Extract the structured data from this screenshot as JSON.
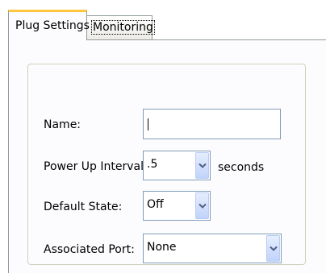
{
  "tabs": [
    {
      "label": "Plug Settings",
      "active": true
    },
    {
      "label": "Monitoring",
      "active": false
    }
  ],
  "form": {
    "name": {
      "label": "Name:",
      "value": ""
    },
    "power_up_interval": {
      "label": "Power Up Interval:",
      "value": ".5",
      "unit": "seconds"
    },
    "default_state": {
      "label": "Default State:",
      "value": "Off"
    },
    "associated_port": {
      "label": "Associated Port:",
      "value": "None"
    }
  },
  "icons": {
    "dropdown": "chevron-down-icon"
  },
  "colors": {
    "active_tab_accent": "#ffc83c",
    "tab_border": "#919b9c",
    "input_border": "#7f9db9",
    "dropdown_button": "#c1d3fb",
    "dropdown_arrow": "#4d6185",
    "group_border": "#d0d0bf"
  }
}
